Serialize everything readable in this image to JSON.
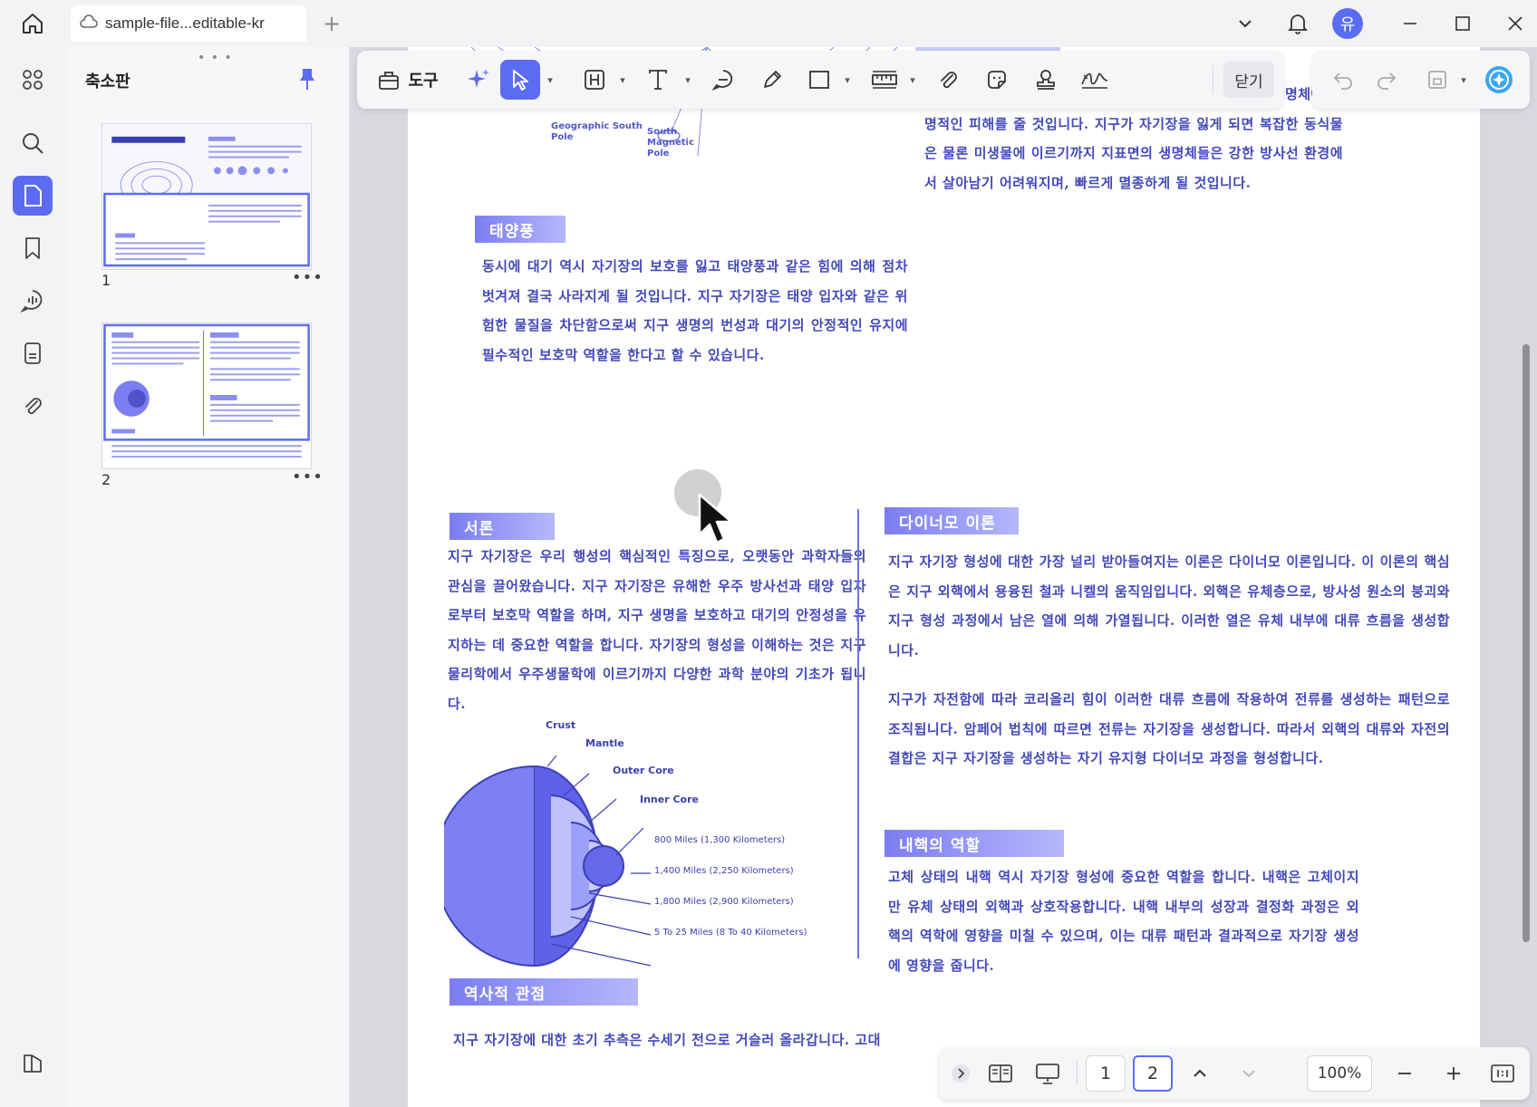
{
  "titlebar": {
    "tab_title": "sample-file...editable-kr",
    "new_tab": "+",
    "avatar_letter": "유"
  },
  "thumbnails": {
    "title": "축소판",
    "grip": "• • •",
    "pages": [
      {
        "number": "1",
        "more": "•••"
      },
      {
        "number": "2",
        "more": "•••"
      }
    ]
  },
  "toolbar": {
    "tools_label": "도구",
    "close_label": "닫기"
  },
  "colors": {
    "accent": "#5b6cf2",
    "heading_gradient_start": "#7b7df0",
    "body_text": "#4249b8"
  },
  "page1": {
    "diagram_labels": {
      "geo_south_pole": "Geographic South Pole",
      "south_magnetic_pole": "South Magnetic Pole"
    },
    "right_paragraph": "이러한 방사선이 아무런 차단 없이 지구에 도달하면 지구 생명체에 치명적인 피해를 줄 것입니다. 지구가 자기장을 잃게 되면 복잡한 동식물은 물론 미생물에 이르기까지 지표면의 생명체들은 강한 방사선 환경에서 살아남기 어려워지며, 빠르게 멸종하게 될 것입니다.",
    "solar_wind_heading": "태양풍",
    "solar_wind_paragraph": "동시에 대기 역시 자기장의 보호를 잃고 태양풍과 같은 힘에 의해 점차 벗겨져 결국 사라지게 될 것입니다. 지구 자기장은 태양 입자와 같은 위험한 물질을 차단함으로써 지구 생명의 번성과 대기의 안정적인 유지에 필수적인 보호막 역할을 한다고 할 수 있습니다."
  },
  "page2": {
    "intro_heading": "서론",
    "intro_paragraph": "지구 자기장은 우리 행성의 핵심적인 특징으로, 오랫동안 과학자들의 관심을 끌어왔습니다. 지구 자기장은 유해한 우주 방사선과 태양 입자로부터 보호막 역할을 하며, 지구 생명을 보호하고 대기의 안정성을 유지하는 데 중요한 역할을 합니다. 자기장의 형성을 이해하는 것은 지구물리학에서 우주생물학에 이르기까지 다양한 과학 분야의 기초가 됩니다.",
    "layers": {
      "crust": "Crust",
      "mantle": "Mantle",
      "outer_core": "Outer Core",
      "inner_core": "Inner Core",
      "d1": "800 Miles (1,300 Kilometers)",
      "d2": "1,400 Miles (2,250 Kilometers)",
      "d3": "1,800 Miles (2,900 Kilometers)",
      "d4": "5 To 25 Miles (8 To 40 Kilometers)"
    },
    "history_heading": "역사적 관점",
    "history_paragraph": "지구 자기장에 대한 초기 추측은 수세기 전으로 거슬러 올라갑니다. 고대",
    "dynamo_heading": "다이너모 이론",
    "dynamo_paragraph1": "지구 자기장 형성에 대한 가장 널리 받아들여지는 이론은 다이너모 이론입니다. 이 이론의 핵심은 지구 외핵에서 용융된 철과 니켈의 움직임입니다. 외핵은 유체층으로, 방사성 원소의 붕괴와 지구 형성 과정에서 남은 열에 의해 가열됩니다. 이러한 열은 유체 내부에 대류 흐름을 생성합니다.",
    "dynamo_paragraph2": "지구가 자전함에 따라 코리올리 힘이 이러한 대류 흐름에 작용하여 전류를 생성하는 패턴으로 조직됩니다. 암페어 법칙에 따르면 전류는 자기장을 생성합니다. 따라서 외핵의 대류와 자전의 결합은 지구 자기장을 생성하는 자기 유지형 다이너모 과정을 형성합니다.",
    "core_heading": "내핵의 역할",
    "core_paragraph": "고체 상태의 내핵 역시 자기장 형성에 중요한 역할을 합니다. 내핵은 고체이지만 유체 상태의 외핵과 상호작용합니다. 내핵 내부의 성장과 결정화 과정은 외핵의 역학에 영향을 미칠 수 있으며, 이는 대류 패턴과 결과적으로 자기장 생성에 영향을 줍니다."
  },
  "bottombar": {
    "page1": "1",
    "page2": "2",
    "zoom": "100%"
  }
}
